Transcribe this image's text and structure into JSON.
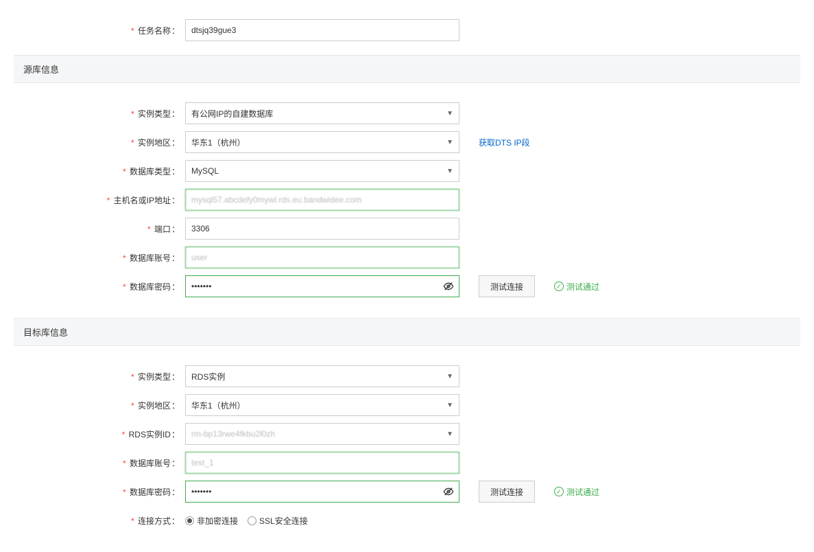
{
  "task": {
    "name_label": "任务名称",
    "name_value": "dtsjq39gue3"
  },
  "source": {
    "title": "源库信息",
    "instance_type_label": "实例类型",
    "instance_type_value": "有公网IP的自建数据库",
    "region_label": "实例地区",
    "region_value": "华东1（杭州）",
    "dts_ip_link": "获取DTS IP段",
    "db_type_label": "数据库类型",
    "db_type_value": "MySQL",
    "host_label": "主机名或IP地址",
    "host_value": "mysql57.abcdefy0mywl.rds.eu.bandwidee.com",
    "port_label": "端口",
    "port_value": "3306",
    "account_label": "数据库账号",
    "account_value": "user",
    "password_label": "数据库密码",
    "password_value": "•••••••",
    "test_btn": "测试连接",
    "test_status": "测试通过"
  },
  "target": {
    "title": "目标库信息",
    "instance_type_label": "实例类型",
    "instance_type_value": "RDS实例",
    "region_label": "实例地区",
    "region_value": "华东1（杭州）",
    "rds_id_label": "RDS实例ID",
    "rds_id_value": "rm-bp13rwe4fkbu2l0zh",
    "account_label": "数据库账号",
    "account_value": "test_1",
    "password_label": "数据库密码",
    "password_value": "•••••••",
    "test_btn": "测试连接",
    "test_status": "测试通过",
    "conn_mode_label": "连接方式",
    "conn_mode_plain": "非加密连接",
    "conn_mode_ssl": "SSL安全连接"
  }
}
